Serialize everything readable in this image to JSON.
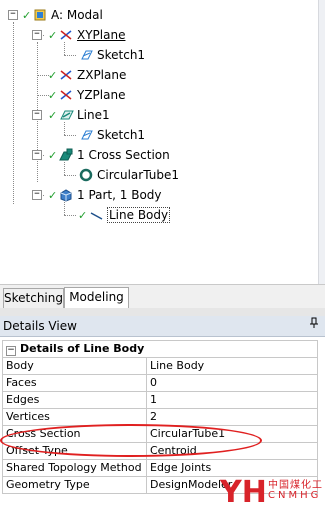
{
  "tree": {
    "root": {
      "label": "A: Modal",
      "expander": "−"
    },
    "nodes": [
      {
        "label": "XYPlane",
        "expander": "−"
      },
      {
        "label": "Sketch1"
      },
      {
        "label": "ZXPlane"
      },
      {
        "label": "YZPlane"
      },
      {
        "label": "Line1",
        "expander": "−"
      },
      {
        "label": "Sketch1"
      },
      {
        "label": "1 Cross Section",
        "expander": "−"
      },
      {
        "label": "CircularTube1"
      },
      {
        "label": "1 Part, 1 Body",
        "expander": "−"
      },
      {
        "label": "Line Body"
      }
    ],
    "check": "✓"
  },
  "tabs": [
    {
      "label": "Sketching",
      "active": false
    },
    {
      "label": "Modeling",
      "active": true
    }
  ],
  "details": {
    "title": "Details View",
    "pin": "ᵖ",
    "group": {
      "label": "Details of Line Body",
      "expander": "−"
    },
    "rows": [
      {
        "key": "Body",
        "value": "Line Body"
      },
      {
        "key": "Faces",
        "value": "0"
      },
      {
        "key": "Edges",
        "value": "1"
      },
      {
        "key": "Vertices",
        "value": "2"
      },
      {
        "key": "Cross Section",
        "value": "CircularTube1"
      },
      {
        "key": "Offset Type",
        "value": "Centroid"
      },
      {
        "key": "Shared Topology Method",
        "value": "Edge Joints"
      },
      {
        "key": "Geometry Type",
        "value": "DesignModeler"
      }
    ]
  },
  "watermark": {
    "line1": "中国煤化工",
    "line2": "CNMHG",
    "logo": "YH"
  },
  "colors": {
    "check": "#1f9e2c",
    "highlight_ellipse": "#e02020",
    "watermark": "#d8232a"
  }
}
